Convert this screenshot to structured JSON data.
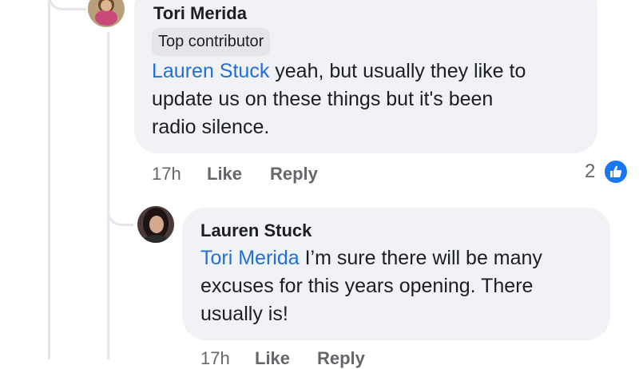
{
  "comments": [
    {
      "author": "Tori Merida",
      "badge": "Top contributor",
      "mention": "Lauren Stuck",
      "text_line1": " yeah, but usually they like to",
      "text_line2": "update us on these things but it's been",
      "text_line3": "radio silence.",
      "time": "17h",
      "like_label": "Like",
      "reply_label": "Reply",
      "reaction_count": "2",
      "reaction_icon": "like-thumb-icon",
      "accent": "#1877f2"
    },
    {
      "author": "Lauren Stuck",
      "mention": "Tori Merida",
      "text_line1": " I’m sure there will be many",
      "text_line2": "excuses for this years opening. There",
      "text_line3": "usually is!",
      "time": "17h",
      "like_label": "Like",
      "reply_label": "Reply"
    }
  ]
}
